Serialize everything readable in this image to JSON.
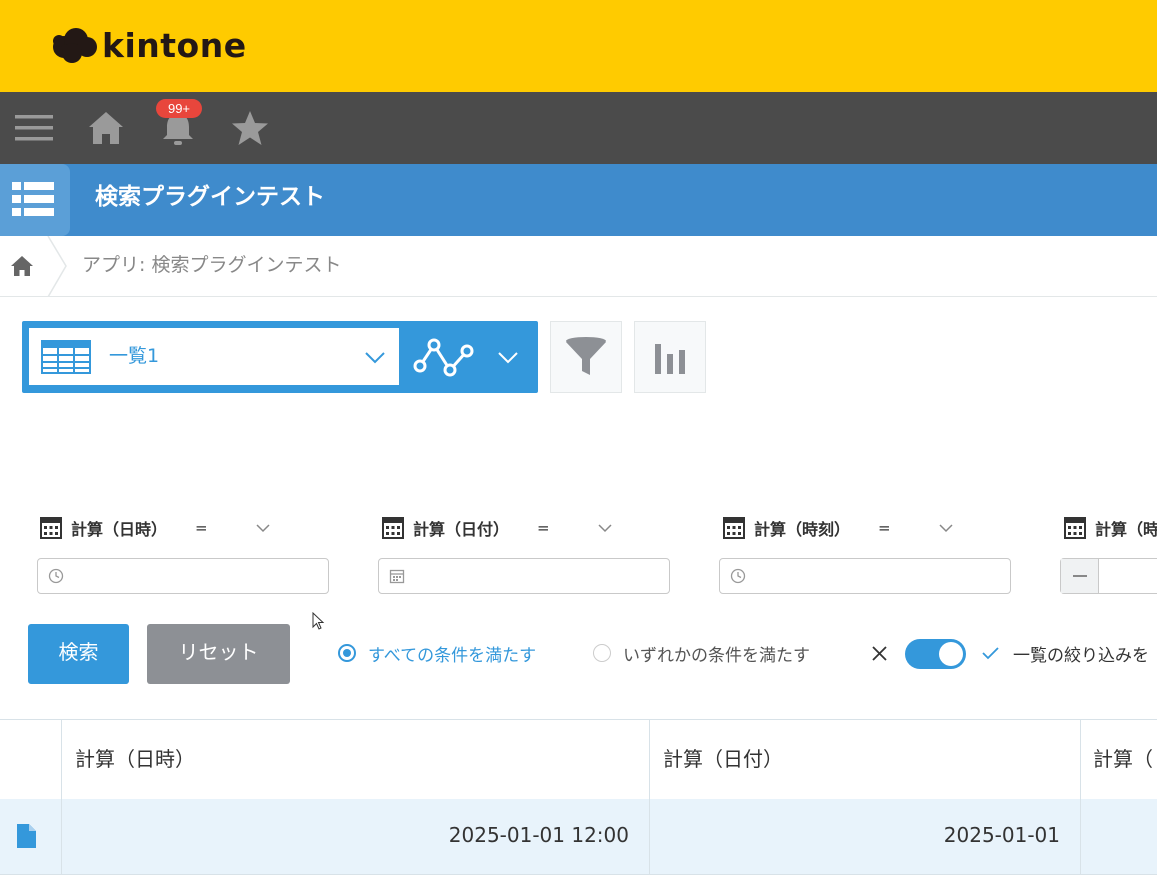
{
  "brand": {
    "name": "kintone"
  },
  "nav": {
    "notification_count": "99+"
  },
  "app": {
    "title": "検索プラグインテスト"
  },
  "breadcrumb": {
    "text": "アプリ: 検索プラグインテスト"
  },
  "view": {
    "selected": "一覧1"
  },
  "filters": [
    {
      "label": "計算（日時）",
      "operator": "=",
      "input_icon": "clock-icon"
    },
    {
      "label": "計算（日付）",
      "operator": "=",
      "input_icon": "calendar-icon"
    },
    {
      "label": "計算（時刻）",
      "operator": "=",
      "input_icon": "clock-icon"
    },
    {
      "label": "計算（時",
      "operator": "",
      "input_icon": "minus-icon"
    }
  ],
  "actions": {
    "search_label": "検索",
    "reset_label": "リセット"
  },
  "match": {
    "all_label": "すべての条件を満たす",
    "any_label": "いずれかの条件を満たす",
    "selected": "all"
  },
  "narrow": {
    "label": "一覧の絞り込みを",
    "enabled": true
  },
  "table": {
    "headers": [
      "計算（日時）",
      "計算（日付）",
      "計算（"
    ],
    "rows": [
      {
        "cells": [
          "2025-01-01 12:00",
          "2025-01-01",
          ""
        ]
      }
    ]
  },
  "colors": {
    "brand_yellow": "#ffcb00",
    "nav_dark": "#4b4b4b",
    "app_blue": "#3f8bcc",
    "accent_blue": "#3498db",
    "badge_red": "#e8463c"
  }
}
